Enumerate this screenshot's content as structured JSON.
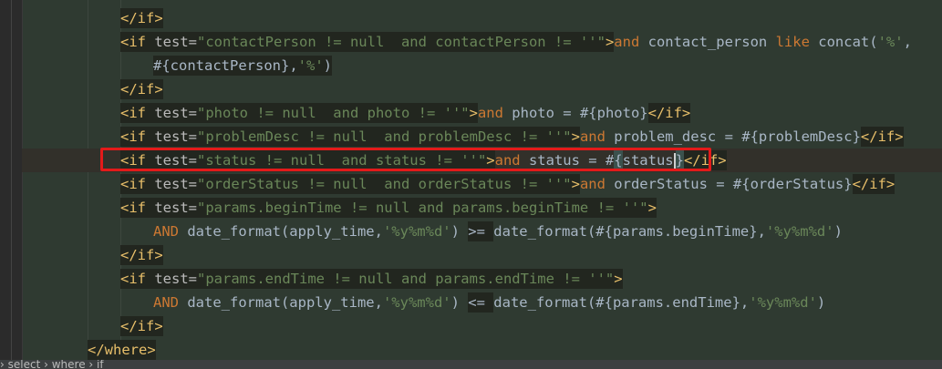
{
  "editor": {
    "lines": [
      {
        "indent": 1,
        "tokens": [
          {
            "t": "</if>",
            "c": "tag",
            "bg": true
          }
        ]
      },
      {
        "indent": 1,
        "tokens": [
          {
            "t": "<if ",
            "c": "tag",
            "bg": true
          },
          {
            "t": "test=",
            "c": "attr",
            "bg": true
          },
          {
            "t": "\"contactPerson != null  and contactPerson != ''\"",
            "c": "str",
            "bg": true
          },
          {
            "t": ">",
            "c": "tag",
            "bg": true
          },
          {
            "t": "and ",
            "c": "kw"
          },
          {
            "t": "contact_person ",
            "c": "sql"
          },
          {
            "t": "like ",
            "c": "kw"
          },
          {
            "t": "concat(",
            "c": "sql"
          },
          {
            "t": "'%'",
            "c": "str"
          },
          {
            "t": ",",
            "c": "sql"
          }
        ]
      },
      {
        "indent": 2,
        "tokens": [
          {
            "t": "#{contactPerson}",
            "c": "ph",
            "bg": true
          },
          {
            "t": ",",
            "c": "sql",
            "bg": true
          },
          {
            "t": "'%'",
            "c": "str",
            "bg": true
          },
          {
            "t": ")",
            "c": "sql",
            "bg": true
          }
        ]
      },
      {
        "indent": 1,
        "tokens": [
          {
            "t": "</if>",
            "c": "tag",
            "bg": true
          }
        ]
      },
      {
        "indent": 1,
        "tokens": [
          {
            "t": "<if ",
            "c": "tag",
            "bg": true
          },
          {
            "t": "test=",
            "c": "attr",
            "bg": true
          },
          {
            "t": "\"photo != null  and photo != ''\"",
            "c": "str",
            "bg": true
          },
          {
            "t": ">",
            "c": "tag",
            "bg": true
          },
          {
            "t": "and ",
            "c": "kw"
          },
          {
            "t": "photo = #{photo}",
            "c": "sql"
          },
          {
            "t": "</if>",
            "c": "tag",
            "bg": true
          }
        ]
      },
      {
        "indent": 1,
        "tokens": [
          {
            "t": "<if ",
            "c": "tag",
            "bg": true
          },
          {
            "t": "test=",
            "c": "attr",
            "bg": true
          },
          {
            "t": "\"problemDesc != null  and problemDesc != ''\"",
            "c": "str",
            "bg": true
          },
          {
            "t": ">",
            "c": "tag",
            "bg": true
          },
          {
            "t": "and ",
            "c": "kw"
          },
          {
            "t": "problem_desc = #{problemDesc}",
            "c": "sql"
          },
          {
            "t": "</if>",
            "c": "tag",
            "bg": true
          }
        ]
      },
      {
        "indent": 1,
        "current": true,
        "tokens": [
          {
            "t": "<if ",
            "c": "tag",
            "bg": true
          },
          {
            "t": "test=",
            "c": "attr",
            "bg": true
          },
          {
            "t": "\"status != null  and status != ''\"",
            "c": "str",
            "bg": true
          },
          {
            "t": ">",
            "c": "tag",
            "bg": true
          },
          {
            "t": "and ",
            "c": "kw"
          },
          {
            "t": "status = #",
            "c": "sql"
          },
          {
            "t": "{",
            "c": "sql",
            "match": true
          },
          {
            "t": "status",
            "c": "sql"
          },
          {
            "t": "}",
            "c": "sql",
            "match": true,
            "caret": true
          },
          {
            "t": "</if>",
            "c": "tag",
            "bg": true
          }
        ]
      },
      {
        "indent": 1,
        "tokens": [
          {
            "t": "<if ",
            "c": "tag",
            "bg": true
          },
          {
            "t": "test=",
            "c": "attr",
            "bg": true
          },
          {
            "t": "\"orderStatus != null  and orderStatus != ''\"",
            "c": "str",
            "bg": true
          },
          {
            "t": ">",
            "c": "tag",
            "bg": true
          },
          {
            "t": "and ",
            "c": "kw"
          },
          {
            "t": "orderStatus = #{orderStatus}",
            "c": "sql"
          },
          {
            "t": "</if>",
            "c": "tag",
            "bg": true
          }
        ]
      },
      {
        "indent": 1,
        "tokens": [
          {
            "t": "<if ",
            "c": "tag",
            "bg": true
          },
          {
            "t": "test=",
            "c": "attr",
            "bg": true
          },
          {
            "t": "\"params.beginTime != null and params.beginTime != ''\"",
            "c": "str",
            "bg": true
          },
          {
            "t": ">",
            "c": "tag",
            "bg": true
          }
        ]
      },
      {
        "indent": 2,
        "tokens": [
          {
            "t": "AND ",
            "c": "kw"
          },
          {
            "t": "date_format(apply_time,",
            "c": "sql"
          },
          {
            "t": "'%y%m%d'",
            "c": "str"
          },
          {
            "t": ") ",
            "c": "sql"
          },
          {
            "t": ">= ",
            "c": "sql",
            "bg": true
          },
          {
            "t": "date_format(#{params.beginTime},",
            "c": "sql"
          },
          {
            "t": "'%y%m%d'",
            "c": "str"
          },
          {
            "t": ")",
            "c": "sql"
          }
        ]
      },
      {
        "indent": 1,
        "tokens": [
          {
            "t": "</if>",
            "c": "tag",
            "bg": true
          }
        ]
      },
      {
        "indent": 1,
        "tokens": [
          {
            "t": "<if ",
            "c": "tag",
            "bg": true
          },
          {
            "t": "test=",
            "c": "attr",
            "bg": true
          },
          {
            "t": "\"params.endTime != null and params.endTime != ''\"",
            "c": "str",
            "bg": true
          },
          {
            "t": ">",
            "c": "tag",
            "bg": true
          }
        ]
      },
      {
        "indent": 2,
        "tokens": [
          {
            "t": "AND ",
            "c": "kw"
          },
          {
            "t": "date_format(apply_time,",
            "c": "sql"
          },
          {
            "t": "'%y%m%d'",
            "c": "str"
          },
          {
            "t": ") ",
            "c": "sql"
          },
          {
            "t": "<= ",
            "c": "sql",
            "bg": true
          },
          {
            "t": "date_format(#{params.endTime},",
            "c": "sql"
          },
          {
            "t": "'%y%m%d'",
            "c": "str"
          },
          {
            "t": ")",
            "c": "sql"
          }
        ]
      },
      {
        "indent": 1,
        "tokens": [
          {
            "t": "</if>",
            "c": "tag",
            "bg": true
          }
        ]
      },
      {
        "indent": 0,
        "tokens": [
          {
            "t": "</where>",
            "c": "tag",
            "bg": true
          }
        ]
      }
    ]
  },
  "breadcrumb": {
    "items": [
      "select",
      "where",
      "if"
    ],
    "separator": "›"
  },
  "colors": {
    "highlight_box": "#e31a1a",
    "tag": "#e8bf6a",
    "string": "#6a8759",
    "keyword": "#cc7832"
  }
}
